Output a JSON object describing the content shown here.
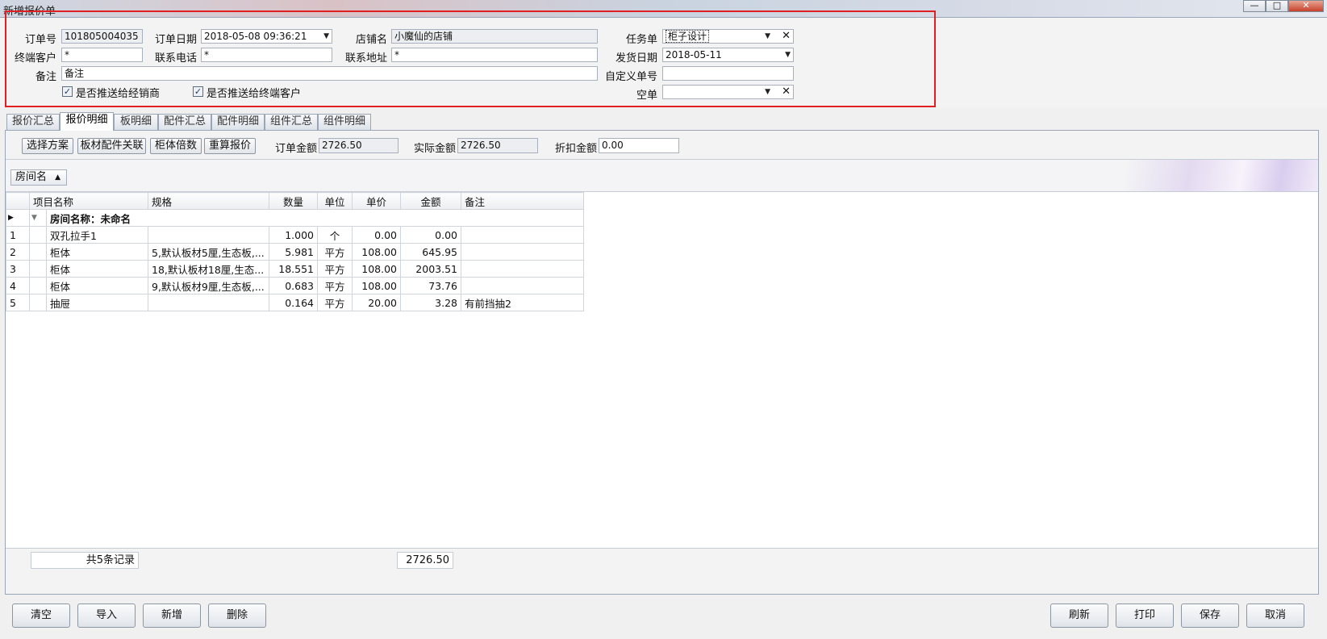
{
  "window": {
    "title": "新增报价单",
    "min": "—",
    "max": "□",
    "close": "✕"
  },
  "header": {
    "order_no": {
      "label": "订单号",
      "value": "101805004035"
    },
    "order_date": {
      "label": "订单日期",
      "value": "2018-05-08 09:36:21"
    },
    "store_name": {
      "label": "店铺名",
      "value": "小魔仙的店铺"
    },
    "task": {
      "label": "任务单",
      "value": "柜子设计"
    },
    "end_customer": {
      "label": "终端客户",
      "value": "*"
    },
    "phone": {
      "label": "联系电话",
      "value": "*"
    },
    "address": {
      "label": "联系地址",
      "value": "*"
    },
    "ship_date": {
      "label": "发货日期",
      "value": "2018-05-11"
    },
    "remark": {
      "label": "备注",
      "value": "备注"
    },
    "custom_no": {
      "label": "自定义单号",
      "value": ""
    },
    "empty_order": {
      "label": "空单",
      "value": ""
    },
    "push_dealer": {
      "label": "是否推送给经销商",
      "checked": true
    },
    "push_customer": {
      "label": "是否推送给终端客户",
      "checked": true
    }
  },
  "tabs": [
    "报价汇总",
    "报价明细",
    "板明细",
    "配件汇总",
    "配件明细",
    "组件汇总",
    "组件明细"
  ],
  "active_tab": "报价明细",
  "toolbar": {
    "select_plan": "选择方案",
    "board_link": "板材配件关联",
    "cabinet_multiple": "柜体倍数",
    "recalc": "重算报价",
    "order_amount_label": "订单金额",
    "order_amount": "2726.50",
    "actual_amount_label": "实际金额",
    "actual_amount": "2726.50",
    "discount_label": "折扣金额",
    "discount": "0.00"
  },
  "group_by": "房间名",
  "grid": {
    "columns": [
      "项目名称",
      "规格",
      "数量",
      "单位",
      "单价",
      "金额",
      "备注"
    ],
    "group_row": "房间名称：未命名",
    "rows": [
      {
        "no": "1",
        "name": "双孔拉手1",
        "spec": "",
        "qty": "1.000",
        "unit": "个",
        "price": "0.00",
        "amount": "0.00",
        "note": ""
      },
      {
        "no": "2",
        "name": "柜体",
        "spec": "5,默认板材5厘,生态板,...",
        "qty": "5.981",
        "unit": "平方",
        "price": "108.00",
        "amount": "645.95",
        "note": ""
      },
      {
        "no": "3",
        "name": "柜体",
        "spec": "18,默认板材18厘,生态...",
        "qty": "18.551",
        "unit": "平方",
        "price": "108.00",
        "amount": "2003.51",
        "note": ""
      },
      {
        "no": "4",
        "name": "柜体",
        "spec": "9,默认板材9厘,生态板,...",
        "qty": "0.683",
        "unit": "平方",
        "price": "108.00",
        "amount": "73.76",
        "note": ""
      },
      {
        "no": "5",
        "name": "抽屉",
        "spec": "",
        "qty": "0.164",
        "unit": "平方",
        "price": "20.00",
        "amount": "3.28",
        "note": "有前挡抽2"
      }
    ]
  },
  "footer": {
    "record_count": "共5条记录",
    "total": "2726.50"
  },
  "buttons": {
    "clear": "清空",
    "import": "导入",
    "add": "新增",
    "delete": "删除",
    "refresh": "刷新",
    "print": "打印",
    "save": "保存",
    "cancel": "取消"
  }
}
